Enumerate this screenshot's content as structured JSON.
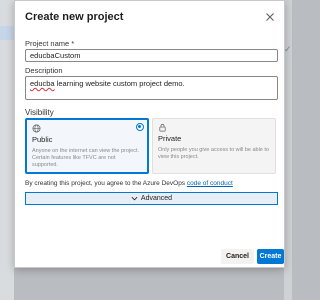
{
  "dialog": {
    "title": "Create new project"
  },
  "form": {
    "name_label": "Project name *",
    "name_value": "educbaCustom",
    "description_label": "Description",
    "description_word": "educba",
    "description_rest": " learning website custom project demo.",
    "visibility_label": "Visibility"
  },
  "visibility": {
    "public": {
      "name": "Public",
      "description": "Anyone on the internet can view the project. Certain features like TFVC are not supported.",
      "icon": "globe-icon",
      "selected": true
    },
    "private": {
      "name": "Private",
      "description": "Only people you give access to will be able to view this project.",
      "icon": "lock-icon",
      "selected": false
    }
  },
  "agreement": {
    "text": "By creating this project, you agree to the Azure DevOps ",
    "link": "code of conduct"
  },
  "advanced": {
    "label": "Advanced",
    "icon": "chevron-down-icon"
  },
  "buttons": {
    "cancel": "Cancel",
    "create": "Create"
  },
  "colors": {
    "accent": "#0078d4",
    "link": "#0063b1"
  }
}
